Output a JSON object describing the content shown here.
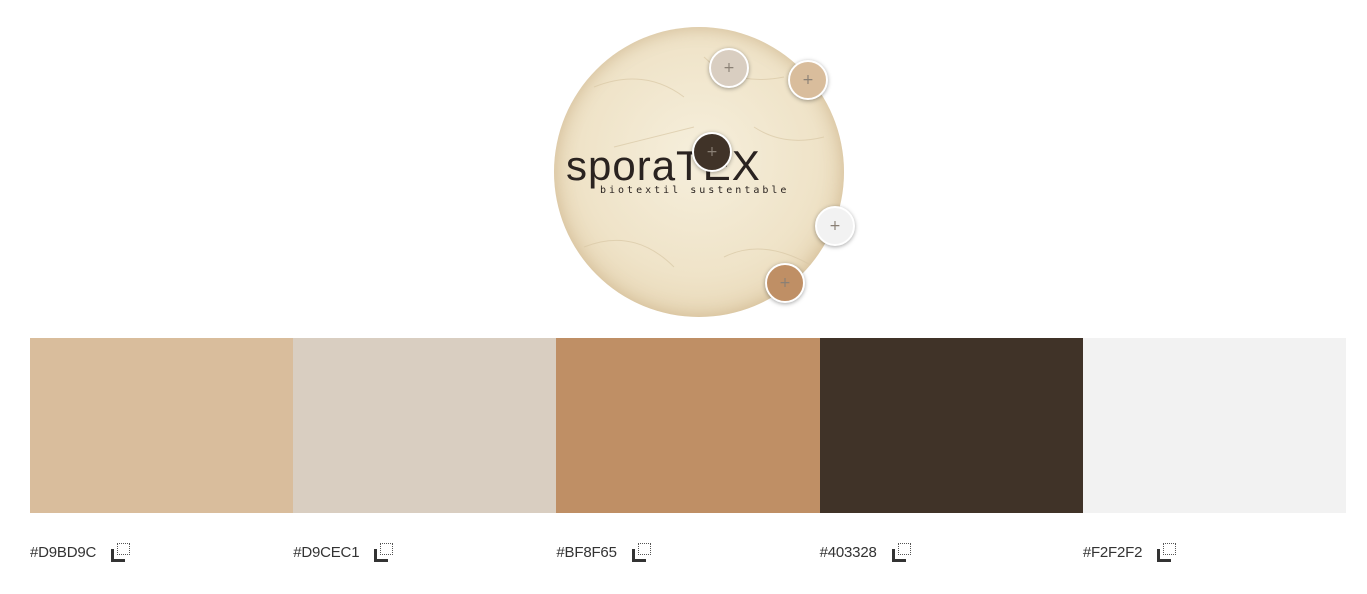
{
  "source_image": {
    "logo_text": "sporaTEX",
    "logo_tagline": "biotextil sustentable"
  },
  "pickers": [
    {
      "name": "picker-1",
      "color": "#D9CEC1",
      "icon": "plus-icon",
      "symbol": "+"
    },
    {
      "name": "picker-2",
      "color": "#D9BD9C",
      "icon": "plus-icon",
      "symbol": "+"
    },
    {
      "name": "picker-3",
      "color": "#403328",
      "icon": "plus-icon",
      "symbol": "+"
    },
    {
      "name": "picker-4",
      "color": "#F2F2F2",
      "icon": "plus-icon",
      "symbol": "+"
    },
    {
      "name": "picker-5",
      "color": "#BF8F65",
      "icon": "plus-icon",
      "symbol": "+"
    }
  ],
  "swatches": [
    {
      "hex": "#D9BD9C",
      "copy_icon": "copy-icon"
    },
    {
      "hex": "#D9CEC1",
      "copy_icon": "copy-icon"
    },
    {
      "hex": "#BF8F65",
      "copy_icon": "copy-icon"
    },
    {
      "hex": "#403328",
      "copy_icon": "copy-icon"
    },
    {
      "hex": "#F2F2F2",
      "copy_icon": "copy-icon"
    }
  ]
}
